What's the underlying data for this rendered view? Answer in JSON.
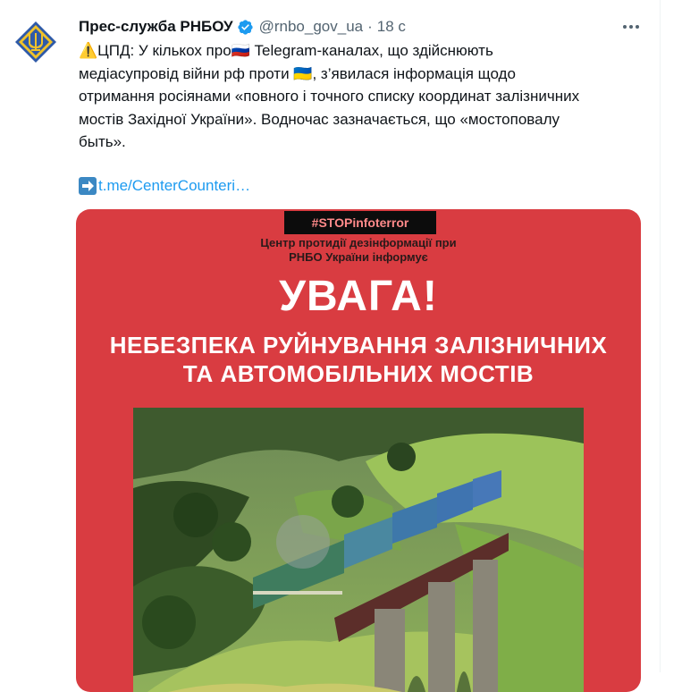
{
  "tweet": {
    "display_name": "Прес-служба РНБОУ",
    "handle": "@rnbo_gov_ua",
    "separator": "·",
    "time": "18 с",
    "text_lines": [
      "⚠️ЦПД: У кількох про🇷🇺 Telegram-каналах, що здійснюють",
      "медіасупровід війни рф проти 🇺🇦, з’явилася інформація щодо",
      "отримання росіянами «повного і точного списку координат залізничних",
      "мостів Західної України». Водночас зазначається, що «мостоповалу",
      "быть»."
    ],
    "link_text": "t.me/CenterCounteri…"
  },
  "card": {
    "hashtag": "#STOPinfoterror",
    "subtitle_line1": "Центр протидії дезінформації при",
    "subtitle_line2": "РНБО України інформує",
    "headline": "УВАГА!",
    "warning_line1": "НЕБЕЗПЕКА РУЙНУВАННЯ ЗАЛІЗНИЧНИХ",
    "warning_line2": "ТА АВТОМОБІЛЬНИХ МОСТІВ"
  },
  "icons": {
    "avatar": "ukraine-trident-emblem-icon",
    "verified": "verified-badge-icon",
    "more": "more-options-icon",
    "link_arrow": "right-arrow-emoji-icon"
  },
  "colors": {
    "verified_blue": "#1d9bf0",
    "card_red": "#d93c41",
    "link_blue": "#1d9bf0"
  }
}
